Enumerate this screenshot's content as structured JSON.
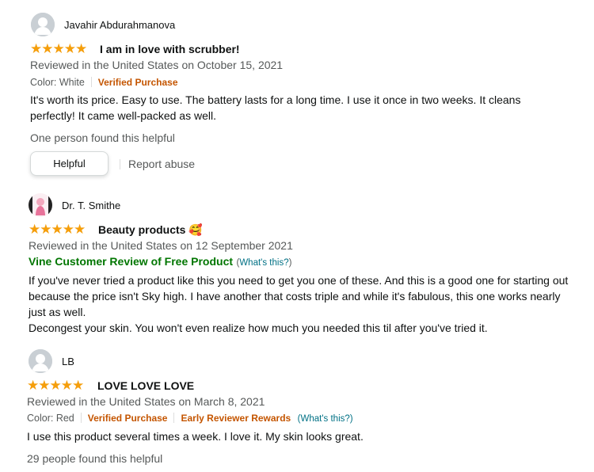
{
  "colors": {
    "star": "#f59e0b",
    "verified": "#c45500",
    "vine": "#007600",
    "link": "#007185"
  },
  "reviews": [
    {
      "reviewer": "Javahir Abdurahmanova",
      "stars": "★★★★★",
      "title": "I am in love with scrubber!",
      "date": "Reviewed in the United States on October 15, 2021",
      "color_label": "Color: White",
      "verified": "Verified Purchase",
      "body": "It's worth its price. Easy to use. The battery lasts for a long time. I use it once in two weeks. It cleans perfectly! It came well-packed as well.",
      "helpful_text": "One person found this helpful",
      "helpful_button": "Helpful",
      "report": "Report abuse"
    },
    {
      "reviewer": "Dr. T. Smithe",
      "stars": "★★★★★",
      "title": "Beauty products",
      "title_emoji": "🥰",
      "date": "Reviewed in the United States on 12 September 2021",
      "vine_label": "Vine Customer Review of Free Product",
      "vine_open": "(",
      "whats_this": "What's this?",
      "vine_close": ")",
      "body_p1": "If you've never tried a product like this you need to get you one of these. And this is a good one for starting out because the price isn't Sky high. I have another that costs triple and while it's fabulous, this one works nearly just as well.",
      "body_p2": "Decongest your skin. You won't even realize how much you needed this til after you've tried it."
    },
    {
      "reviewer": "LB",
      "stars": "★★★★★",
      "title": "LOVE LOVE LOVE",
      "date": "Reviewed in the United States on March 8, 2021",
      "color_label": "Color: Red",
      "verified": "Verified Purchase",
      "early": "Early Reviewer Rewards",
      "whats_this": "(What's this?)",
      "body": "I use this product several times a week. I love it. My skin looks great.",
      "helpful_text": "29 people found this helpful"
    }
  ]
}
